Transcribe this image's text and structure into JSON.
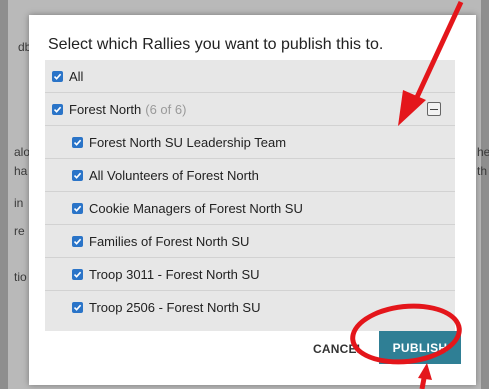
{
  "background": {
    "fragments": [
      "db",
      "alo",
      "ha",
      "in",
      "re",
      "tio",
      "he",
      "th"
    ]
  },
  "modal": {
    "title": "Select which Rallies you want to publish this to.",
    "all_label": "All",
    "group": {
      "label": "Forest North",
      "count": "(6 of 6)",
      "items": [
        "Forest North SU Leadership Team",
        "All Volunteers of Forest North",
        "Cookie Managers of Forest North SU",
        "Families of Forest North SU",
        "Troop 3011 - Forest North SU",
        "Troop 2506 - Forest North SU"
      ]
    },
    "cancel_label": "CANCEL",
    "publish_label": "PUBLISH"
  },
  "colors": {
    "checkbox": "#2a74c8",
    "publish_button": "#2f7f95",
    "annotation": "#e4161b"
  },
  "icons": {
    "checkbox": "checkmark-icon",
    "collapse": "minus-icon"
  }
}
